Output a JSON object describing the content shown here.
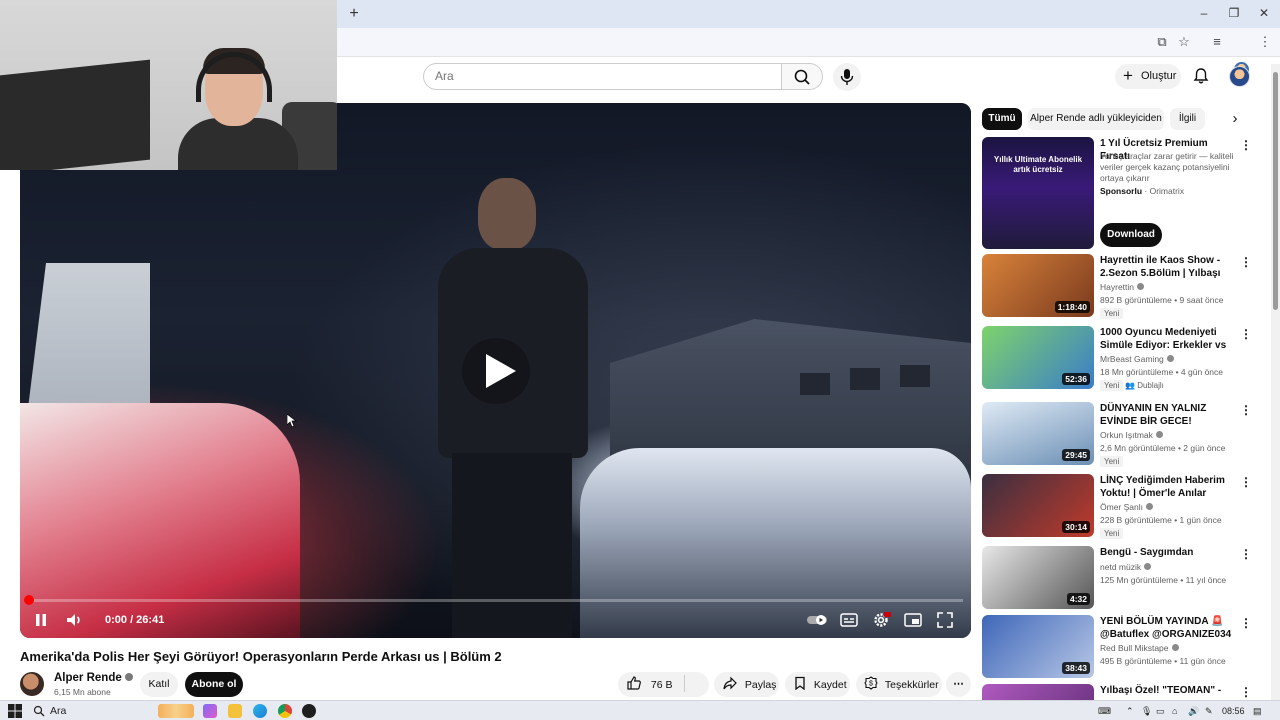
{
  "browser": {
    "new_tab_label": "+"
  },
  "header": {
    "search_placeholder": "Ara",
    "create_label": "Oluştur"
  },
  "player": {
    "time": "0:00 / 26:41",
    "progress_fraction": 0.0
  },
  "video": {
    "title": "Amerika'da Polis Her Şeyi Görüyor! Operasyonların Perde Arkası us | Bölüm 2",
    "channel": "Alper Rende",
    "subs": "6,15 Mn abone",
    "join_label": "Katıl",
    "subscribe_label": "Abone ol",
    "likes": "76 B",
    "share_label": "Paylaş",
    "save_label": "Kaydet",
    "thanks_label": "Teşekkürler"
  },
  "sidebar": {
    "chips": [
      "Tümü",
      "Alper Rende adlı yükleyiciden",
      "İlgili"
    ],
    "ad": {
      "thumb_text": "Yıllık Ultimate Abonelik artık ücretsiz",
      "title": "1 Yıl Ücretsiz Premium Fırsatı",
      "description": "Yanlış araçlar zarar getirir — kaliteli veriler gerçek kazanç potansiyelini ortaya çıkarır",
      "sponsored": "Sponsorlu",
      "advertiser": "Orimatrix",
      "button": "Download"
    },
    "videos": [
      {
        "title": "Hayrettin ile Kaos Show - 2.Sezon 5.Bölüm | Yılbaşı Özel...",
        "channel": "Hayrettin",
        "meta": "892 B görüntüleme • 9 saat önce",
        "badge": "Yeni",
        "duration": "1:18:40",
        "color": "#c3542b"
      },
      {
        "title": "1000 Oyuncu Medeniyeti Simüle Ediyor: Erkekler vs Kızlar",
        "channel": "MrBeast Gaming",
        "meta": "18 Mn görüntüleme • 4 gün önce",
        "badge": "Yeni",
        "badge2": "Dublajlı",
        "duration": "52:36",
        "color": "#4aa34a"
      },
      {
        "title": "DÜNYANIN EN YALNIZ EVİNDE BİR GECE!",
        "channel": "Orkun Işıtmak",
        "meta": "2,6 Mn görüntüleme • 2 gün önce",
        "badge": "Yeni",
        "duration": "29:45",
        "color": "#7fa7c9"
      },
      {
        "title": "LİNÇ Yediğimden Haberim Yoktu! | Ömer'le Anılar @gokalaf",
        "channel": "Ömer Şanlı",
        "meta": "228 B görüntüleme • 1 gün önce",
        "badge": "Yeni",
        "duration": "30:14",
        "color": "#2a2230"
      },
      {
        "title": "Bengü - Saygımdan",
        "channel": "netd müzik",
        "meta": "125 Mn görüntüleme • 11 yıl önce",
        "duration": "4:32",
        "color": "#bdbdbd"
      },
      {
        "title": "YENİ BÖLÜM YAYINDA 🚨 @Batuflex @ORGANIZE034 ...",
        "channel": "Red Bull Mikstape",
        "meta": "495 B görüntüleme • 11 gün önce",
        "duration": "38:43",
        "color": "#3b5fa8"
      },
      {
        "title": "Yılbaşı Özel! \"TEOMAN\" -",
        "color": "#8e3ea8"
      }
    ]
  },
  "taskbar": {
    "search": "Ara",
    "clock": "08:56"
  }
}
